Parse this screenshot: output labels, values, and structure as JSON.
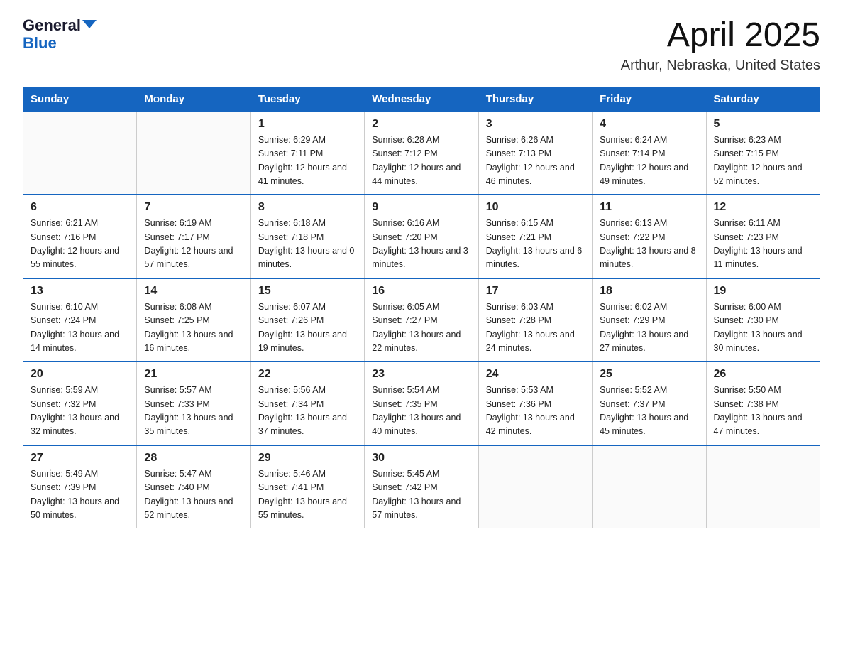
{
  "header": {
    "logo_general": "General",
    "logo_blue": "Blue",
    "main_title": "April 2025",
    "subtitle": "Arthur, Nebraska, United States"
  },
  "days_of_week": [
    "Sunday",
    "Monday",
    "Tuesday",
    "Wednesday",
    "Thursday",
    "Friday",
    "Saturday"
  ],
  "weeks": [
    [
      {
        "num": "",
        "sunrise": "",
        "sunset": "",
        "daylight": ""
      },
      {
        "num": "",
        "sunrise": "",
        "sunset": "",
        "daylight": ""
      },
      {
        "num": "1",
        "sunrise": "Sunrise: 6:29 AM",
        "sunset": "Sunset: 7:11 PM",
        "daylight": "Daylight: 12 hours and 41 minutes."
      },
      {
        "num": "2",
        "sunrise": "Sunrise: 6:28 AM",
        "sunset": "Sunset: 7:12 PM",
        "daylight": "Daylight: 12 hours and 44 minutes."
      },
      {
        "num": "3",
        "sunrise": "Sunrise: 6:26 AM",
        "sunset": "Sunset: 7:13 PM",
        "daylight": "Daylight: 12 hours and 46 minutes."
      },
      {
        "num": "4",
        "sunrise": "Sunrise: 6:24 AM",
        "sunset": "Sunset: 7:14 PM",
        "daylight": "Daylight: 12 hours and 49 minutes."
      },
      {
        "num": "5",
        "sunrise": "Sunrise: 6:23 AM",
        "sunset": "Sunset: 7:15 PM",
        "daylight": "Daylight: 12 hours and 52 minutes."
      }
    ],
    [
      {
        "num": "6",
        "sunrise": "Sunrise: 6:21 AM",
        "sunset": "Sunset: 7:16 PM",
        "daylight": "Daylight: 12 hours and 55 minutes."
      },
      {
        "num": "7",
        "sunrise": "Sunrise: 6:19 AM",
        "sunset": "Sunset: 7:17 PM",
        "daylight": "Daylight: 12 hours and 57 minutes."
      },
      {
        "num": "8",
        "sunrise": "Sunrise: 6:18 AM",
        "sunset": "Sunset: 7:18 PM",
        "daylight": "Daylight: 13 hours and 0 minutes."
      },
      {
        "num": "9",
        "sunrise": "Sunrise: 6:16 AM",
        "sunset": "Sunset: 7:20 PM",
        "daylight": "Daylight: 13 hours and 3 minutes."
      },
      {
        "num": "10",
        "sunrise": "Sunrise: 6:15 AM",
        "sunset": "Sunset: 7:21 PM",
        "daylight": "Daylight: 13 hours and 6 minutes."
      },
      {
        "num": "11",
        "sunrise": "Sunrise: 6:13 AM",
        "sunset": "Sunset: 7:22 PM",
        "daylight": "Daylight: 13 hours and 8 minutes."
      },
      {
        "num": "12",
        "sunrise": "Sunrise: 6:11 AM",
        "sunset": "Sunset: 7:23 PM",
        "daylight": "Daylight: 13 hours and 11 minutes."
      }
    ],
    [
      {
        "num": "13",
        "sunrise": "Sunrise: 6:10 AM",
        "sunset": "Sunset: 7:24 PM",
        "daylight": "Daylight: 13 hours and 14 minutes."
      },
      {
        "num": "14",
        "sunrise": "Sunrise: 6:08 AM",
        "sunset": "Sunset: 7:25 PM",
        "daylight": "Daylight: 13 hours and 16 minutes."
      },
      {
        "num": "15",
        "sunrise": "Sunrise: 6:07 AM",
        "sunset": "Sunset: 7:26 PM",
        "daylight": "Daylight: 13 hours and 19 minutes."
      },
      {
        "num": "16",
        "sunrise": "Sunrise: 6:05 AM",
        "sunset": "Sunset: 7:27 PM",
        "daylight": "Daylight: 13 hours and 22 minutes."
      },
      {
        "num": "17",
        "sunrise": "Sunrise: 6:03 AM",
        "sunset": "Sunset: 7:28 PM",
        "daylight": "Daylight: 13 hours and 24 minutes."
      },
      {
        "num": "18",
        "sunrise": "Sunrise: 6:02 AM",
        "sunset": "Sunset: 7:29 PM",
        "daylight": "Daylight: 13 hours and 27 minutes."
      },
      {
        "num": "19",
        "sunrise": "Sunrise: 6:00 AM",
        "sunset": "Sunset: 7:30 PM",
        "daylight": "Daylight: 13 hours and 30 minutes."
      }
    ],
    [
      {
        "num": "20",
        "sunrise": "Sunrise: 5:59 AM",
        "sunset": "Sunset: 7:32 PM",
        "daylight": "Daylight: 13 hours and 32 minutes."
      },
      {
        "num": "21",
        "sunrise": "Sunrise: 5:57 AM",
        "sunset": "Sunset: 7:33 PM",
        "daylight": "Daylight: 13 hours and 35 minutes."
      },
      {
        "num": "22",
        "sunrise": "Sunrise: 5:56 AM",
        "sunset": "Sunset: 7:34 PM",
        "daylight": "Daylight: 13 hours and 37 minutes."
      },
      {
        "num": "23",
        "sunrise": "Sunrise: 5:54 AM",
        "sunset": "Sunset: 7:35 PM",
        "daylight": "Daylight: 13 hours and 40 minutes."
      },
      {
        "num": "24",
        "sunrise": "Sunrise: 5:53 AM",
        "sunset": "Sunset: 7:36 PM",
        "daylight": "Daylight: 13 hours and 42 minutes."
      },
      {
        "num": "25",
        "sunrise": "Sunrise: 5:52 AM",
        "sunset": "Sunset: 7:37 PM",
        "daylight": "Daylight: 13 hours and 45 minutes."
      },
      {
        "num": "26",
        "sunrise": "Sunrise: 5:50 AM",
        "sunset": "Sunset: 7:38 PM",
        "daylight": "Daylight: 13 hours and 47 minutes."
      }
    ],
    [
      {
        "num": "27",
        "sunrise": "Sunrise: 5:49 AM",
        "sunset": "Sunset: 7:39 PM",
        "daylight": "Daylight: 13 hours and 50 minutes."
      },
      {
        "num": "28",
        "sunrise": "Sunrise: 5:47 AM",
        "sunset": "Sunset: 7:40 PM",
        "daylight": "Daylight: 13 hours and 52 minutes."
      },
      {
        "num": "29",
        "sunrise": "Sunrise: 5:46 AM",
        "sunset": "Sunset: 7:41 PM",
        "daylight": "Daylight: 13 hours and 55 minutes."
      },
      {
        "num": "30",
        "sunrise": "Sunrise: 5:45 AM",
        "sunset": "Sunset: 7:42 PM",
        "daylight": "Daylight: 13 hours and 57 minutes."
      },
      {
        "num": "",
        "sunrise": "",
        "sunset": "",
        "daylight": ""
      },
      {
        "num": "",
        "sunrise": "",
        "sunset": "",
        "daylight": ""
      },
      {
        "num": "",
        "sunrise": "",
        "sunset": "",
        "daylight": ""
      }
    ]
  ]
}
